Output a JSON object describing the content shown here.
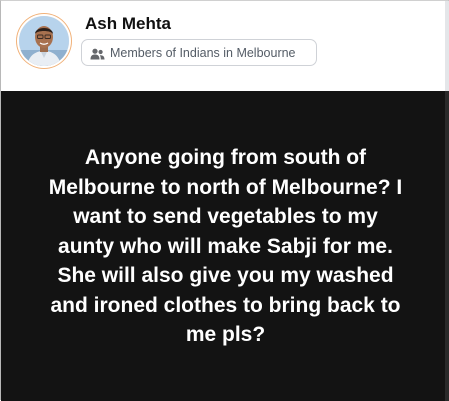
{
  "post": {
    "author": {
      "name": "Ash Mehta",
      "avatar_icon": "avatar-photo"
    },
    "group_chip": {
      "icon": "members-icon",
      "label": "Members of Indians in Melbourne"
    },
    "body_lines": [
      "Anyone going from south of",
      "Melbourne to north of Melbourne? I",
      "want to send vegetables to my",
      "aunty who will make Sabji for me.",
      "She will also give you my washed",
      "and ironed clothes to bring back to",
      "me pls?"
    ],
    "colors": {
      "post_background": "#131313",
      "post_text": "#ffffff",
      "author_text": "#111111",
      "chip_text": "#545c66"
    }
  }
}
